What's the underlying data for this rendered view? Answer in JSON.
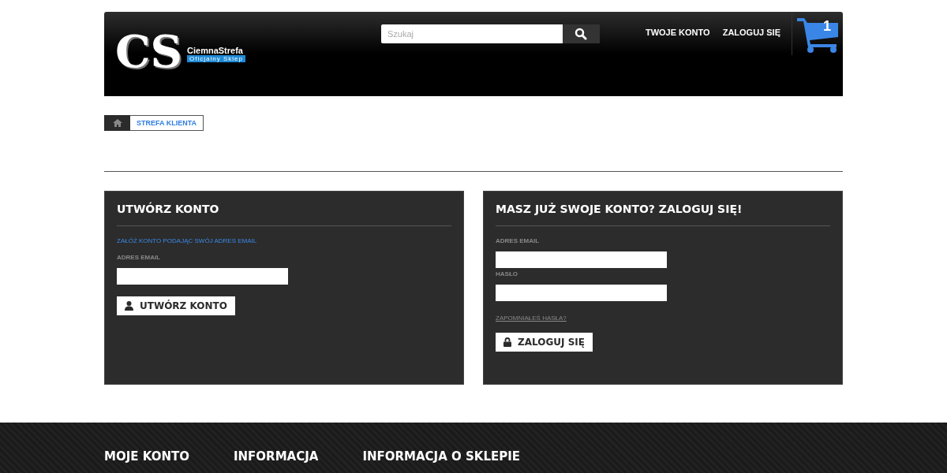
{
  "header": {
    "logo": {
      "monogram": "CS",
      "name": "CiemnaStrefa",
      "tagline": "Oficjalny Sklep"
    },
    "search": {
      "placeholder": "Szukaj"
    },
    "nav": [
      "TWOJE KONTO",
      "ZALOGUJ SIĘ"
    ],
    "cart": {
      "count": "1"
    }
  },
  "breadcrumb": [
    "STREFA KLIENTA"
  ],
  "panels": [
    {
      "title": "UTWÓRZ KONTO",
      "intro": "ZAŁÓŻ KONTO PODAJĄC SWÓJ ADRES EMAIL",
      "fields": [
        {
          "label": "ADRES EMAIL"
        }
      ],
      "kind": "signup",
      "button": {
        "label": "UTWÓRZ KONTO"
      }
    },
    {
      "title": "MASZ JUŻ SWOJE KONTO? ZALOGUJ SIĘ!",
      "fields": [
        {
          "label": "ADRES EMAIL"
        },
        {
          "label": "HASŁO"
        }
      ],
      "link": "ZAPOMNIAŁEŚ HASŁA?",
      "kind": "login",
      "button": {
        "label": "ZALOGUJ SIĘ"
      }
    }
  ],
  "footer": {
    "headings": [
      "MOJE KONTO",
      "INFORMACJA",
      "INFORMACJA O SKLEPIE"
    ]
  }
}
